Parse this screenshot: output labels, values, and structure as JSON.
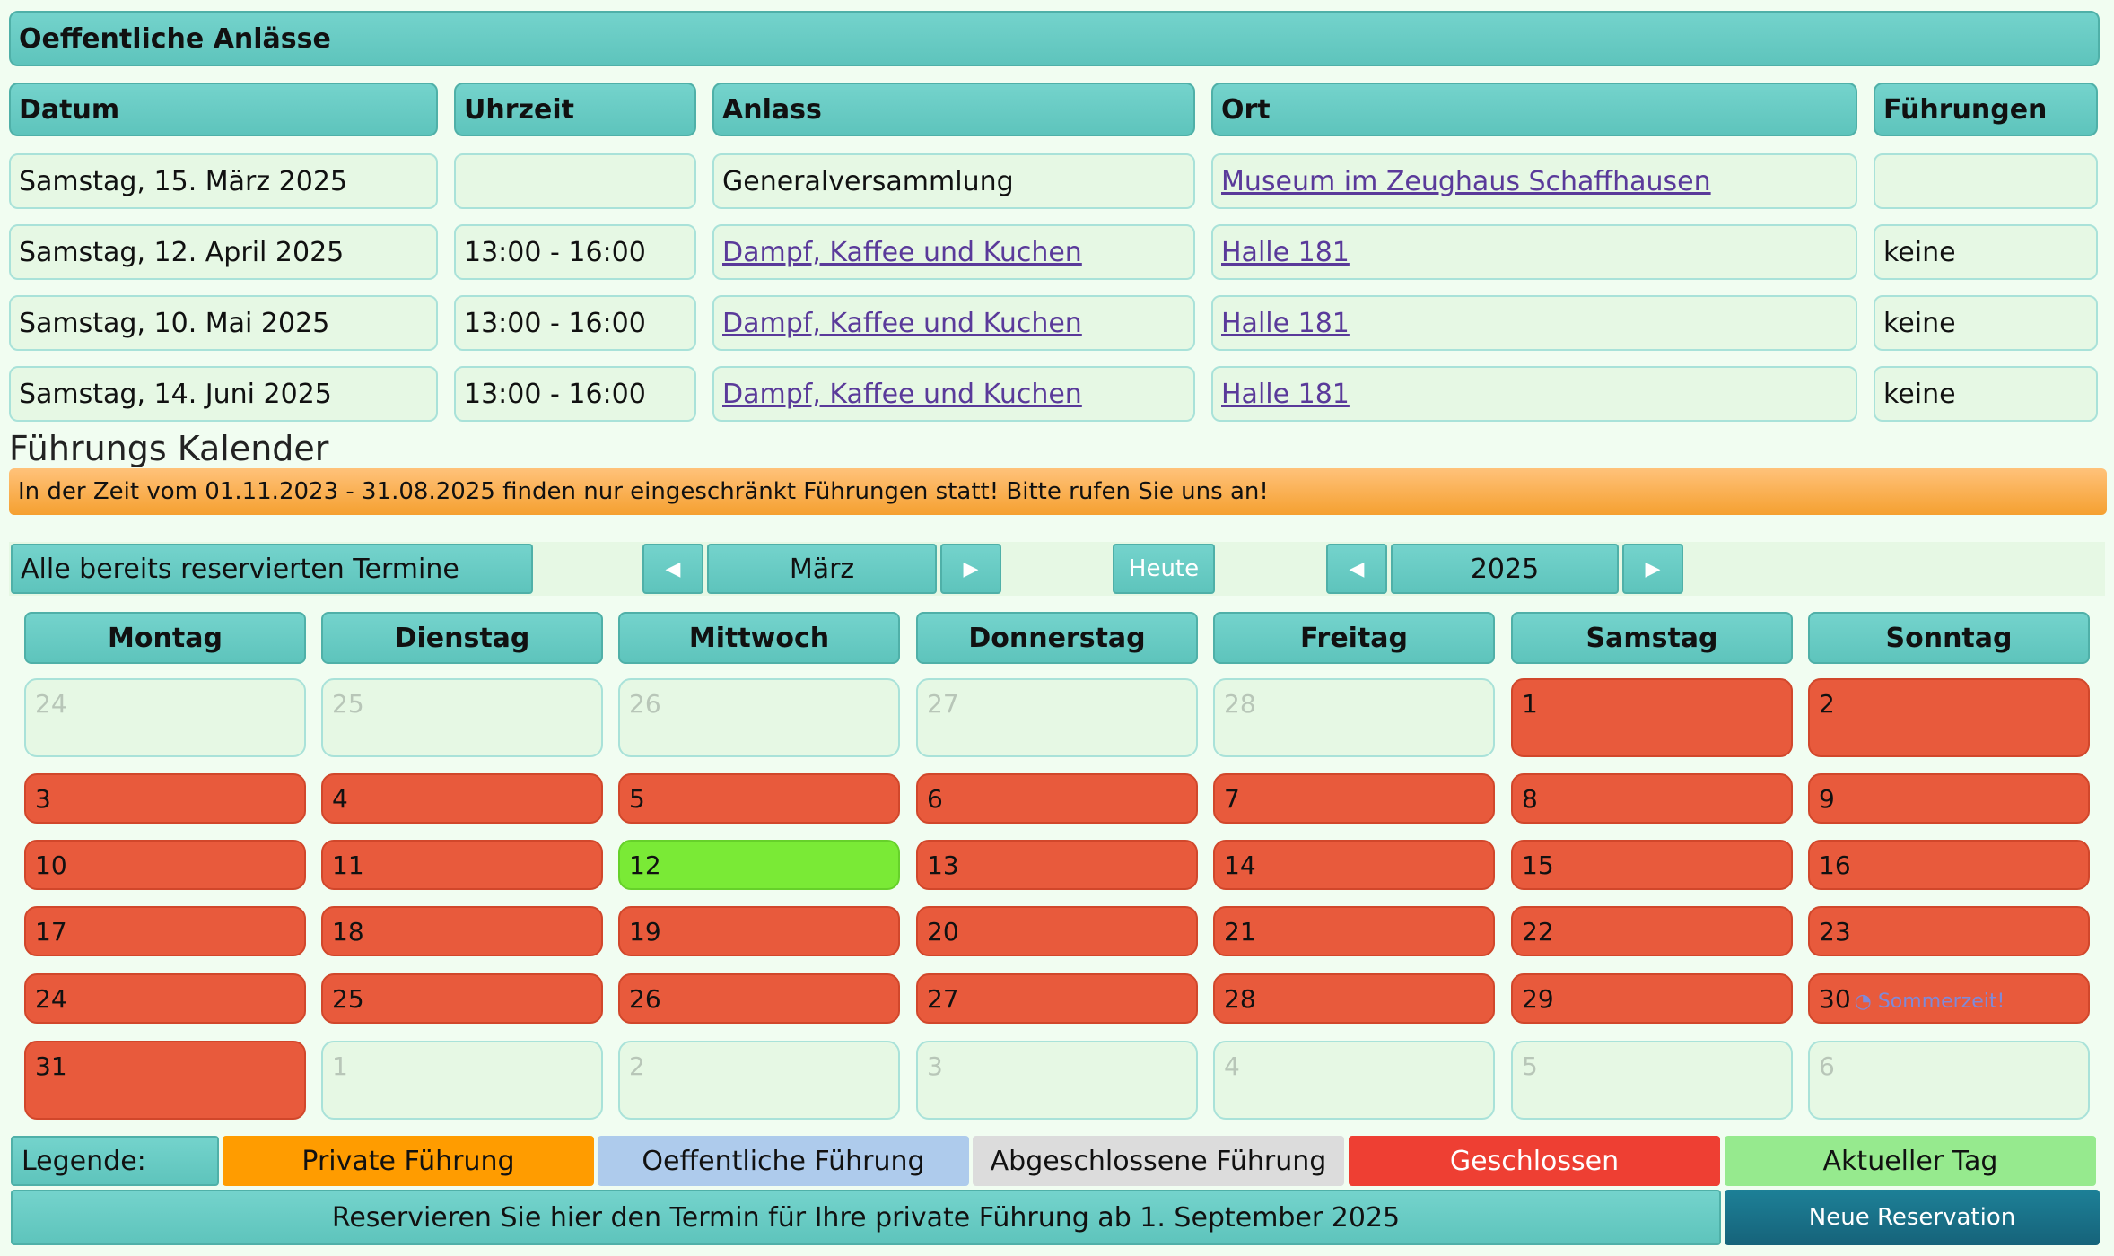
{
  "events": {
    "title": "Oeffentliche Anlässe",
    "headers": [
      "Datum",
      "Uhrzeit",
      "Anlass",
      "Ort",
      "Führungen"
    ],
    "rows": [
      {
        "datum": "Samstag, 15. März 2025",
        "uhrzeit": "",
        "anlass": "Generalversammlung",
        "anlass_link": false,
        "ort": "Museum im Zeughaus Schaffhausen",
        "fuehrungen": ""
      },
      {
        "datum": "Samstag, 12. April 2025",
        "uhrzeit": "13:00 - 16:00",
        "anlass": "Dampf, Kaffee und Kuchen",
        "anlass_link": true,
        "ort": "Halle 181",
        "fuehrungen": "keine"
      },
      {
        "datum": "Samstag, 10. Mai 2025",
        "uhrzeit": "13:00 - 16:00",
        "anlass": "Dampf, Kaffee und Kuchen",
        "anlass_link": true,
        "ort": "Halle 181",
        "fuehrungen": "keine"
      },
      {
        "datum": "Samstag, 14. Juni 2025",
        "uhrzeit": "13:00 - 16:00",
        "anlass": "Dampf, Kaffee und Kuchen",
        "anlass_link": true,
        "ort": "Halle 181",
        "fuehrungen": "keine"
      }
    ]
  },
  "calendar": {
    "title": "Führungs Kalender",
    "notice": "In der Zeit vom 01.11.2023 - 31.08.2025 finden nur eingeschränkt Führungen statt! Bitte rufen Sie uns an!",
    "reserved_button": "Alle bereits reservierten Termine",
    "month": "März",
    "today_button": "Heute",
    "year": "2025",
    "prev_arrow": "◀",
    "next_arrow": "▶",
    "weekdays": [
      "Montag",
      "Dienstag",
      "Mittwoch",
      "Donnerstag",
      "Freitag",
      "Samstag",
      "Sonntag"
    ],
    "weeks": [
      [
        {
          "d": "24",
          "s": "other"
        },
        {
          "d": "25",
          "s": "other"
        },
        {
          "d": "26",
          "s": "other"
        },
        {
          "d": "27",
          "s": "other"
        },
        {
          "d": "28",
          "s": "other"
        },
        {
          "d": "1",
          "s": "closed"
        },
        {
          "d": "2",
          "s": "closed"
        }
      ],
      [
        {
          "d": "3",
          "s": "closed"
        },
        {
          "d": "4",
          "s": "closed"
        },
        {
          "d": "5",
          "s": "closed"
        },
        {
          "d": "6",
          "s": "closed"
        },
        {
          "d": "7",
          "s": "closed"
        },
        {
          "d": "8",
          "s": "closed"
        },
        {
          "d": "9",
          "s": "closed"
        }
      ],
      [
        {
          "d": "10",
          "s": "closed"
        },
        {
          "d": "11",
          "s": "closed"
        },
        {
          "d": "12",
          "s": "today"
        },
        {
          "d": "13",
          "s": "closed"
        },
        {
          "d": "14",
          "s": "closed"
        },
        {
          "d": "15",
          "s": "closed"
        },
        {
          "d": "16",
          "s": "closed"
        }
      ],
      [
        {
          "d": "17",
          "s": "closed"
        },
        {
          "d": "18",
          "s": "closed"
        },
        {
          "d": "19",
          "s": "closed"
        },
        {
          "d": "20",
          "s": "closed"
        },
        {
          "d": "21",
          "s": "closed"
        },
        {
          "d": "22",
          "s": "closed"
        },
        {
          "d": "23",
          "s": "closed"
        }
      ],
      [
        {
          "d": "24",
          "s": "closed"
        },
        {
          "d": "25",
          "s": "closed"
        },
        {
          "d": "26",
          "s": "closed"
        },
        {
          "d": "27",
          "s": "closed"
        },
        {
          "d": "28",
          "s": "closed"
        },
        {
          "d": "29",
          "s": "closed"
        },
        {
          "d": "30",
          "s": "closed",
          "note": "Sommerzeit!"
        }
      ],
      [
        {
          "d": "31",
          "s": "closed"
        },
        {
          "d": "1",
          "s": "other"
        },
        {
          "d": "2",
          "s": "other"
        },
        {
          "d": "3",
          "s": "other"
        },
        {
          "d": "4",
          "s": "other"
        },
        {
          "d": "5",
          "s": "other"
        },
        {
          "d": "6",
          "s": "other"
        }
      ]
    ],
    "sommer_icon": "◔"
  },
  "legend": {
    "label": "Legende:",
    "items": [
      {
        "label": "Private Führung",
        "color": "#ff9c00",
        "text_color": "#111"
      },
      {
        "label": "Oeffentliche Führung",
        "color": "#aecbec",
        "text_color": "#111"
      },
      {
        "label": "Abgeschlossene Führung",
        "color": "#dcdcdc",
        "text_color": "#111"
      },
      {
        "label": "Geschlossen",
        "color": "#ee3f33",
        "text_color": "#ffffff"
      },
      {
        "label": "Aktueller Tag",
        "color": "#96ea8e",
        "text_color": "#111"
      }
    ]
  },
  "footer": {
    "info": "Reservieren Sie hier den Termin für Ihre private Führung ab 1. September 2025",
    "new_reservation": "Neue Reservation"
  },
  "colors": {
    "teal": "#6ccfc7",
    "closed_day": "#e85a3c",
    "today_day": "#7aea36",
    "notice": "#f7ad4d",
    "reservation_button": "#1a6f87"
  }
}
